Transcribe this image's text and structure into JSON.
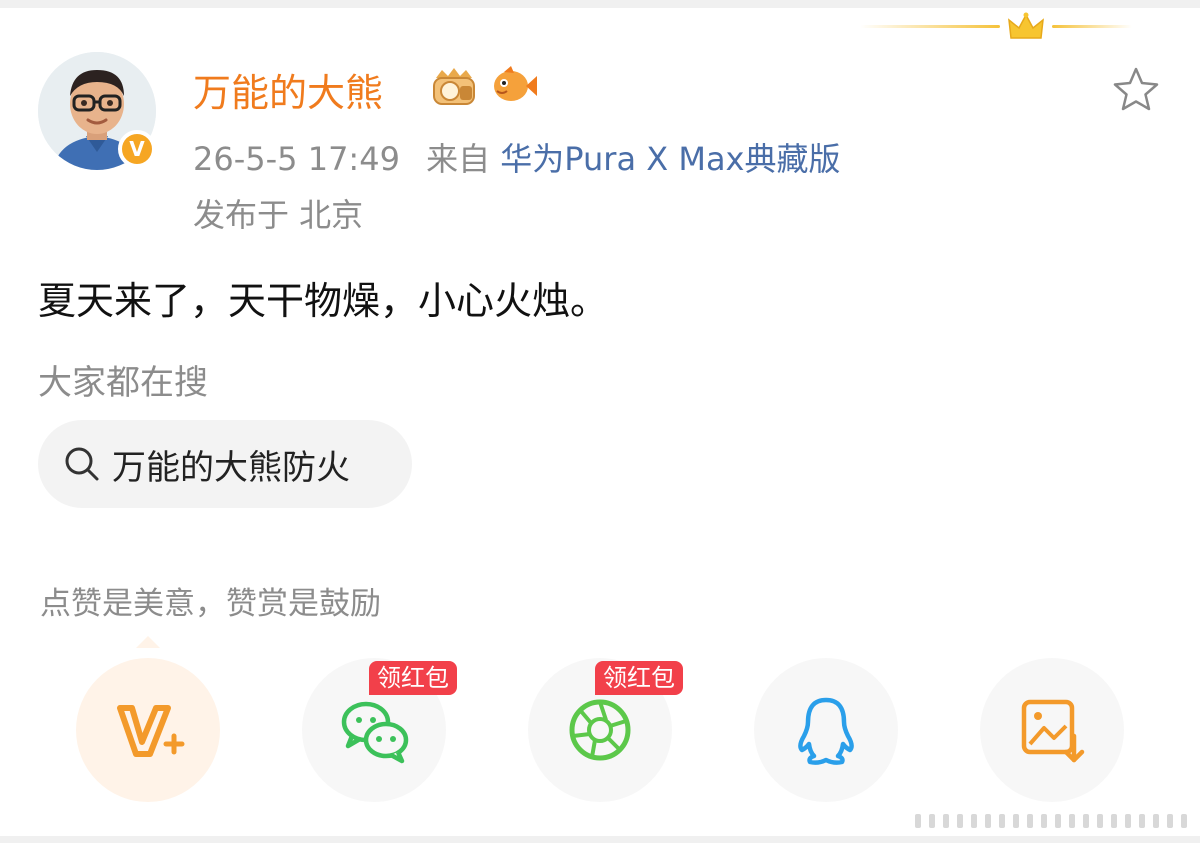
{
  "post": {
    "username": "万能的大熊",
    "timestamp": "26-5-5 17:49",
    "from_label": "来自",
    "device": "华为Pura X Max典藏版",
    "location": "发布于 北京",
    "verified_badge": "V",
    "content": "夏天来了，天干物燥，小心火烛。"
  },
  "search": {
    "heading": "大家都在搜",
    "chip_text": "万能的大熊防火"
  },
  "reward": {
    "text": "点赞是美意，赞赏是鼓励"
  },
  "share_buttons": [
    {
      "name": "weibo-v-plus",
      "tag": ""
    },
    {
      "name": "wechat",
      "tag": "领红包"
    },
    {
      "name": "wechat-moments",
      "tag": "领红包"
    },
    {
      "name": "qq",
      "tag": ""
    },
    {
      "name": "save-image",
      "tag": ""
    }
  ],
  "icons": [
    "crown-icon",
    "level-badge-icon",
    "fish-badge-icon",
    "star-icon",
    "search-icon",
    "v-plus-icon",
    "wechat-icon",
    "moments-icon",
    "qq-icon",
    "save-image-icon"
  ],
  "colors": {
    "username": "#f07b1d",
    "device_link": "#4a6ea8",
    "meta": "#8c8c8c",
    "red_tag": "#f2404a",
    "wechat_green": "#3cc15a",
    "qq_blue": "#2a9fea",
    "accent_orange": "#f39a2b"
  }
}
